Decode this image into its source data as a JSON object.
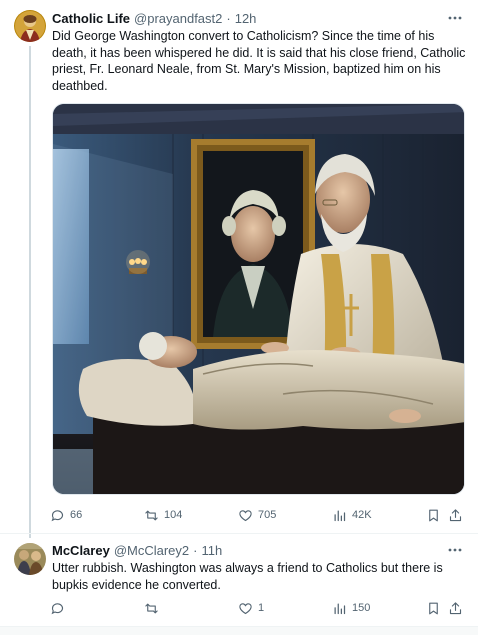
{
  "tweet": {
    "author": {
      "display_name": "Catholic Life",
      "handle": "@prayandfast2",
      "separator": "·",
      "time": "12h"
    },
    "text": "Did George Washington convert to Catholicism?  Since the time of his death, it has been whispered he did.  It is said that his close friend, Catholic priest, Fr. Leonard Neale, from St. Mary's Mission, baptized him on his deathbed.",
    "actions": {
      "replies": "66",
      "retweets": "104",
      "likes": "705",
      "views": "42K"
    }
  },
  "reply": {
    "author": {
      "display_name": "McClarey",
      "handle": "@McClarey2",
      "separator": "·",
      "time": "11h"
    },
    "text": "Utter rubbish. Washington was always a friend to Catholics but there is bupkis evidence he converted.",
    "actions": {
      "replies": "",
      "retweets": "",
      "likes": "1",
      "views": "150"
    }
  },
  "icons": {
    "more": "more-icon",
    "reply": "reply-icon",
    "retweet": "retweet-icon",
    "like": "heart-icon",
    "views": "views-icon",
    "bookmark": "bookmark-icon",
    "share": "share-icon"
  },
  "colors": {
    "text": "#0f1419",
    "secondary": "#536471",
    "border": "#cfd9de"
  }
}
